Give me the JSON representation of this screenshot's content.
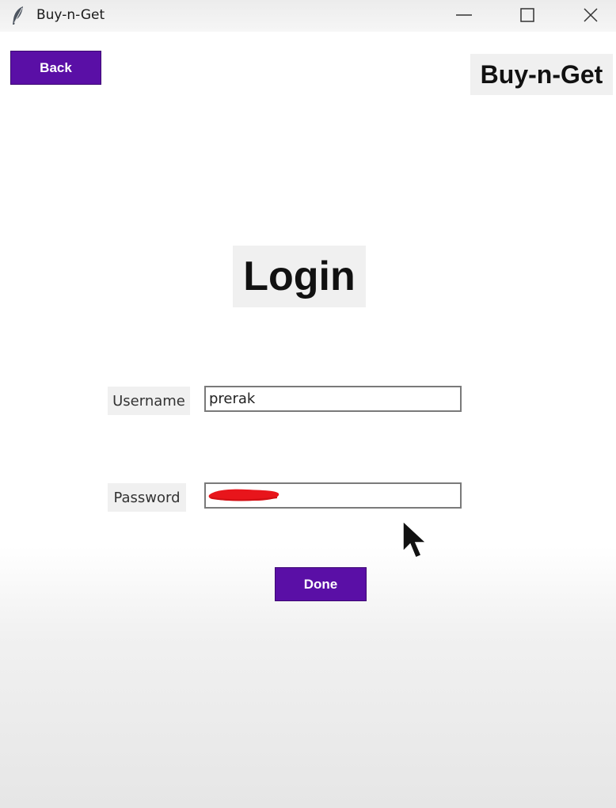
{
  "window": {
    "title": "Buy-n-Get",
    "icon": "feather-icon",
    "controls": [
      "minimize-icon",
      "maximize-icon",
      "close-icon"
    ]
  },
  "header": {
    "back_label": "Back",
    "brand": "Buy-n-Get"
  },
  "form": {
    "heading": "Login",
    "username_label": "Username",
    "username_value": "prerak",
    "password_label": "Password",
    "password_value": "",
    "submit_label": "Done"
  },
  "colors": {
    "accent": "#5a0fa6",
    "label_bg": "#f0f0f0",
    "redaction": "#e8151b"
  }
}
